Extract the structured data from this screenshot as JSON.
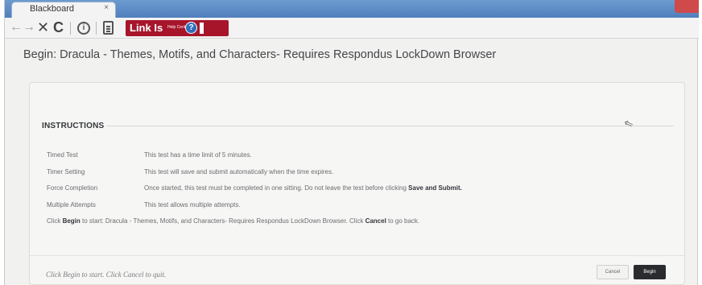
{
  "browser": {
    "tab_title": "Blackboard",
    "tab_close": "×",
    "nav_back": "←",
    "nav_forward": "→",
    "nav_stop": "✕",
    "nav_reload": "C",
    "info_glyph": "i",
    "icons": {
      "back": "back-arrow-icon",
      "forward": "forward-arrow-icon",
      "stop": "close-icon",
      "reload": "reload-icon",
      "info": "info-icon",
      "reader": "document-icon",
      "help": "help-icon"
    }
  },
  "link_bar": {
    "logo_text": "Link Is",
    "help_text": "Help Center",
    "help_glyph": "?",
    "brand_color": "#a7152b"
  },
  "page": {
    "title": "Begin: Dracula - Themes, Motifs, and Characters- Requires Respondus LockDown Browser"
  },
  "instructions": {
    "heading": "INSTRUCTIONS",
    "rows": [
      {
        "label": "Timed Test",
        "value": "This test has a time limit of 5 minutes."
      },
      {
        "label": "Timer Setting",
        "value": "This test will save and submit automatically when the time expires."
      },
      {
        "label": "Force Completion",
        "value_prefix": "Once started, this test must be completed in one sitting. Do not leave the test before clicking ",
        "value_bold": "Save and Submit."
      },
      {
        "label": "Multiple Attempts",
        "value": "This test allows multiple attempts."
      }
    ],
    "click_note": {
      "p1": "Click ",
      "b1": "Begin",
      "p2": " to start: Dracula - Themes, Motifs, and Characters- Requires Respondus LockDown Browser. Click ",
      "b2": "Cancel",
      "p3": " to go back."
    }
  },
  "footer": {
    "text": "Click Begin to start. Click Cancel to quit.",
    "cancel_label": "Cancel",
    "begin_label": "Begin"
  }
}
